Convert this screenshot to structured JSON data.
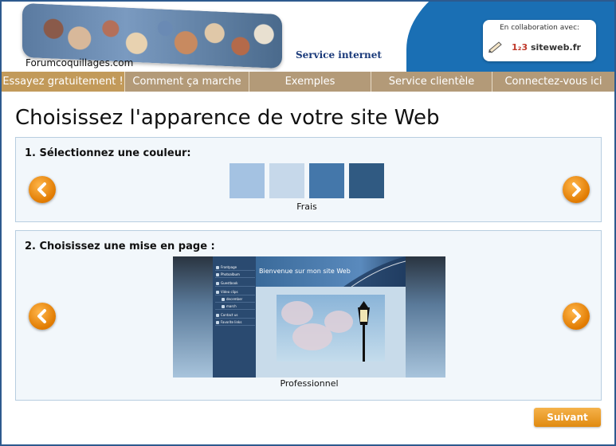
{
  "header": {
    "site_name": "Forumcoquillages.com",
    "service_label": "Service internet",
    "collab_title": "En collaboration avec:",
    "partner_logo_prefix": "1₂3",
    "partner_logo_name": "siteweb.fr"
  },
  "nav": {
    "items": [
      {
        "label": "Essayez gratuitement !"
      },
      {
        "label": "Comment ça marche"
      },
      {
        "label": "Exemples"
      },
      {
        "label": "Service clientèle"
      },
      {
        "label": "Connectez-vous ici"
      }
    ]
  },
  "page_title": "Choisissez l'apparence de votre site Web",
  "color_section": {
    "heading": "1. Sélectionnez une couleur:",
    "selected_name": "Frais",
    "swatches": [
      "#a4c2e2",
      "#c6d8ea",
      "#4477aa",
      "#305a82"
    ]
  },
  "layout_section": {
    "heading": "2. Choisissez une mise en page :",
    "selected_name": "Professionnel",
    "preview": {
      "banner_title": "Bienvenue sur mon site Web",
      "menu": [
        {
          "label": "Frontpage",
          "sub": false
        },
        {
          "label": "Photoalbum",
          "sub": false
        },
        {
          "label": "Guestbook",
          "sub": false
        },
        {
          "label": "Video clips",
          "sub": false
        },
        {
          "label": "december",
          "sub": true
        },
        {
          "label": "march",
          "sub": true
        },
        {
          "label": "Contact us",
          "sub": false
        },
        {
          "label": "Favorite links",
          "sub": false
        }
      ]
    }
  },
  "next_button": "Suivant",
  "colors": {
    "nav_bg": "#b39a78",
    "nav_active": "#c29a5a",
    "accent_orange": "#e08a10",
    "frame_blue": "#2d5a8e"
  }
}
